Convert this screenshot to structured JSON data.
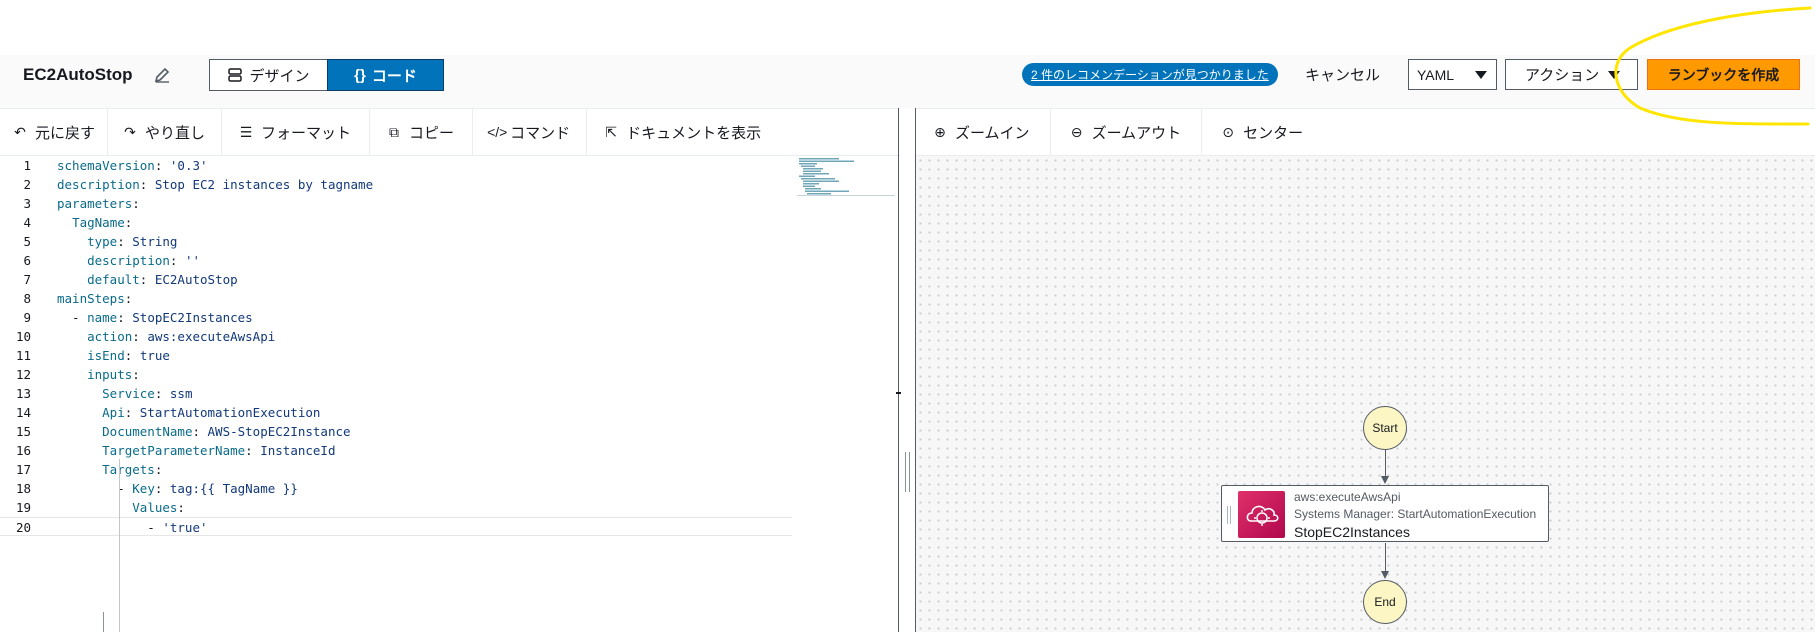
{
  "header": {
    "title": "EC2AutoStop",
    "design_tab": "デザイン",
    "code_tab": "コード",
    "recommendations": "2 件のレコメンデーションが見つかりました",
    "cancel": "キャンセル",
    "format_select": "YAML",
    "actions": "アクション",
    "create": "ランブックを作成"
  },
  "editor_toolbar": {
    "undo": "元に戻す",
    "redo": "やり直し",
    "format": "フォーマット",
    "copy": "コピー",
    "command": "コマンド",
    "view_doc": "ドキュメントを表示"
  },
  "canvas_toolbar": {
    "zoom_in": "ズームイン",
    "zoom_out": "ズームアウト",
    "center": "センター"
  },
  "code_lines": [
    {
      "n": "1",
      "indent": "",
      "key": "schemaVersion",
      "val": "'0.3'"
    },
    {
      "n": "2",
      "indent": "",
      "key": "description",
      "val": "Stop EC2 instances by tagname"
    },
    {
      "n": "3",
      "indent": "",
      "key": "parameters",
      "val": ""
    },
    {
      "n": "4",
      "indent": "  ",
      "key": "TagName",
      "val": ""
    },
    {
      "n": "5",
      "indent": "    ",
      "key": "type",
      "val": "String"
    },
    {
      "n": "6",
      "indent": "    ",
      "key": "description",
      "val": "''"
    },
    {
      "n": "7",
      "indent": "    ",
      "key": "default",
      "val": "EC2AutoStop"
    },
    {
      "n": "8",
      "indent": "",
      "key": "mainSteps",
      "val": ""
    },
    {
      "n": "9",
      "indent": "  - ",
      "key": "name",
      "val": "StopEC2Instances"
    },
    {
      "n": "10",
      "indent": "    ",
      "key": "action",
      "val": "aws:executeAwsApi"
    },
    {
      "n": "11",
      "indent": "    ",
      "key": "isEnd",
      "val": "true"
    },
    {
      "n": "12",
      "indent": "    ",
      "key": "inputs",
      "val": ""
    },
    {
      "n": "13",
      "indent": "      ",
      "key": "Service",
      "val": "ssm"
    },
    {
      "n": "14",
      "indent": "      ",
      "key": "Api",
      "val": "StartAutomationExecution"
    },
    {
      "n": "15",
      "indent": "      ",
      "key": "DocumentName",
      "val": "AWS-StopEC2Instance"
    },
    {
      "n": "16",
      "indent": "      ",
      "key": "TargetParameterName",
      "val": "InstanceId"
    },
    {
      "n": "17",
      "indent": "      ",
      "key": "Targets",
      "val": ""
    },
    {
      "n": "18",
      "indent": "        - ",
      "key": "Key",
      "val": "tag:{{ TagName }}"
    },
    {
      "n": "19",
      "indent": "          ",
      "key": "Values",
      "val": ""
    },
    {
      "n": "20",
      "indent": "            - ",
      "key": "",
      "val": "'true'"
    }
  ],
  "flow": {
    "start": "Start",
    "end": "End",
    "step": {
      "action": "aws:executeAwsApi",
      "service": "Systems Manager: StartAutomationExecution",
      "name": "StopEC2Instances"
    }
  },
  "colors": {
    "primary": "#0073bb",
    "create_button": "#ff9900",
    "annotation": "#ffe500",
    "node_fill": "#fbf6c4",
    "step_icon": "#e0306a"
  },
  "icons": [
    "edit-icon",
    "design-icon",
    "code-icon",
    "undo-icon",
    "redo-icon",
    "format-icon",
    "copy-icon",
    "command-icon",
    "external-link-icon",
    "zoom-in-icon",
    "zoom-out-icon",
    "center-icon",
    "automation-icon"
  ]
}
